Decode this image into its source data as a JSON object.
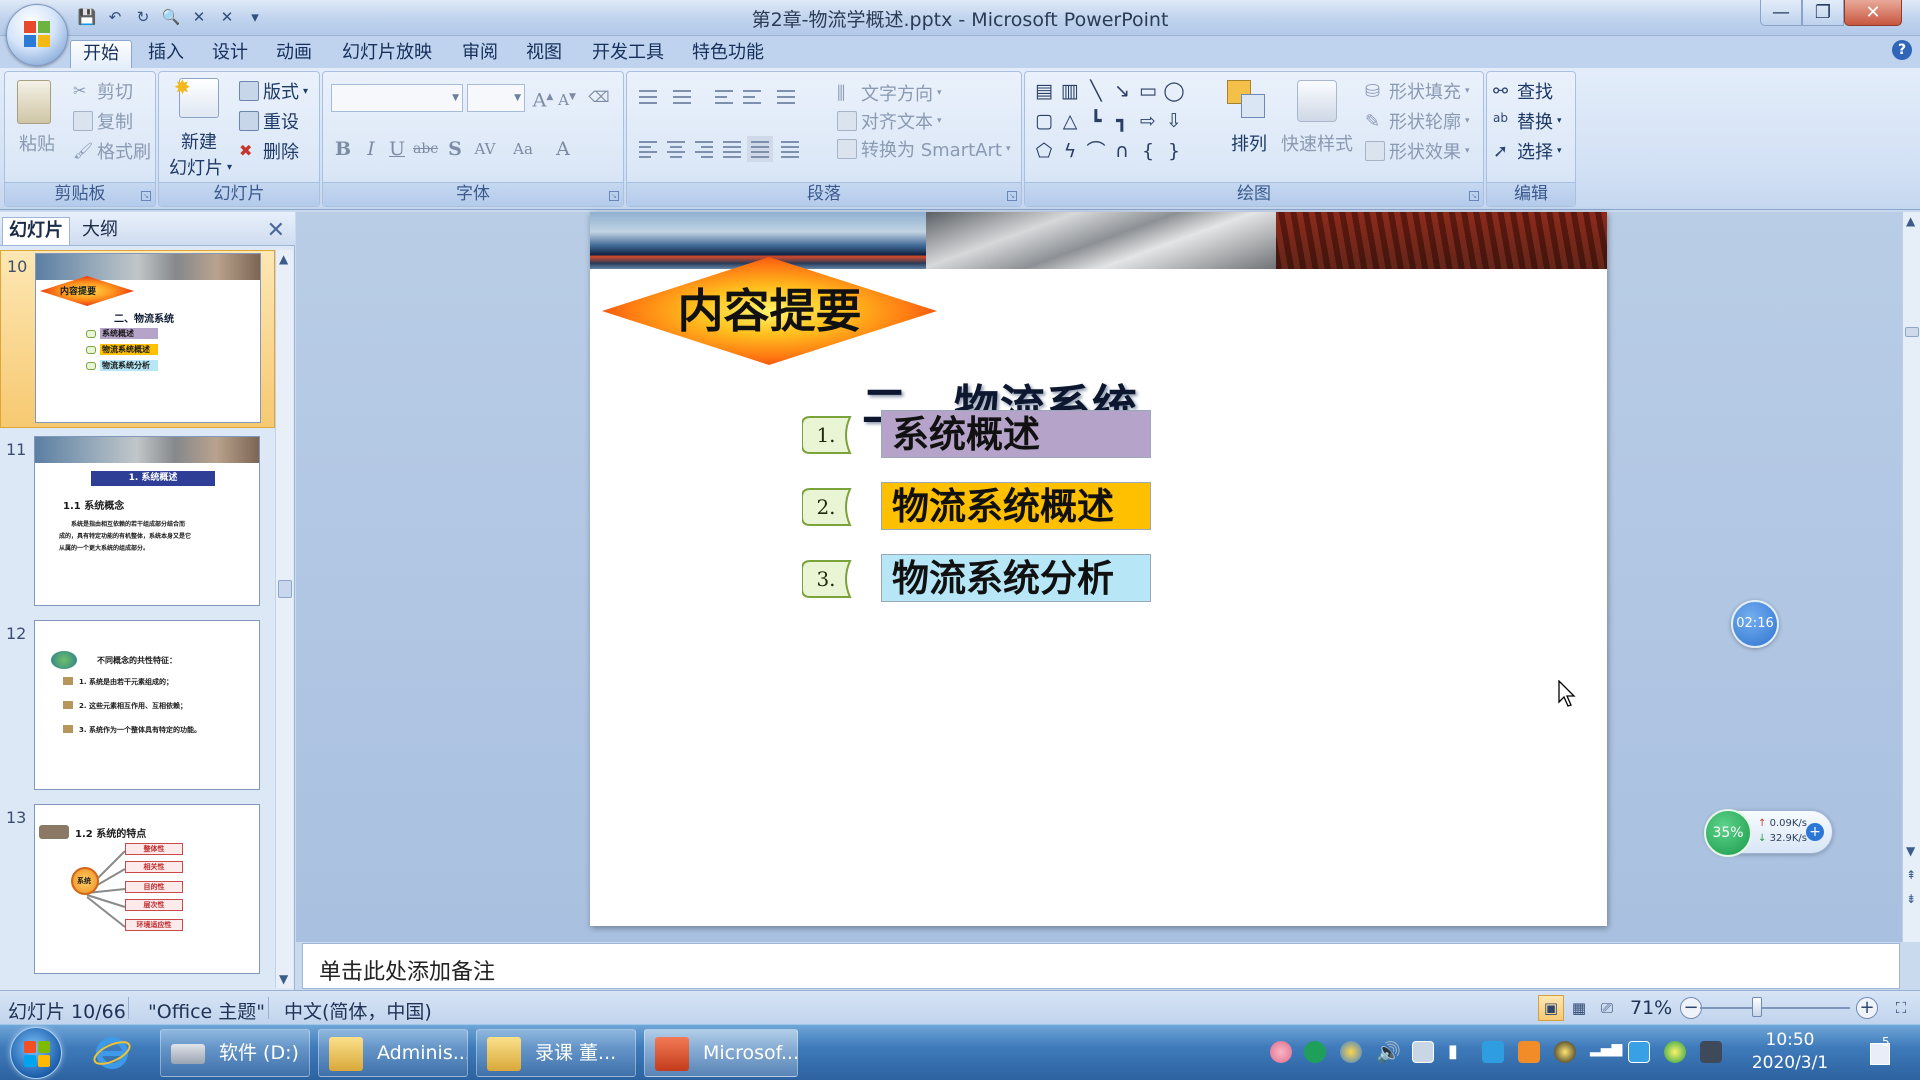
{
  "window": {
    "title": "第2章-物流学概述.pptx - Microsoft PowerPoint",
    "controls": {
      "minimize": "—",
      "maximize": "❐",
      "close": "✕"
    }
  },
  "ribbon_tabs": [
    "开始",
    "插入",
    "设计",
    "动画",
    "幻灯片放映",
    "审阅",
    "视图",
    "开发工具",
    "特色功能"
  ],
  "ribbon": {
    "clipboard": {
      "label": "剪贴板",
      "paste": "粘贴",
      "cut": "剪切",
      "copy": "复制",
      "format_painter": "格式刷"
    },
    "slides": {
      "label": "幻灯片",
      "new_slide": "新建",
      "new_slide_2": "幻灯片",
      "layout": "版式",
      "reset": "重设",
      "delete": "删除"
    },
    "font": {
      "label": "字体",
      "font_name": "",
      "font_size": ""
    },
    "paragraph": {
      "label": "段落",
      "text_direction": "文字方向",
      "align_text": "对齐文本",
      "convert_smartart": "转换为 SmartArt"
    },
    "drawing": {
      "label": "绘图",
      "arrange": "排列",
      "quick_styles": "快速样式",
      "shape_fill": "形状填充",
      "shape_outline": "形状轮廓",
      "shape_effects": "形状效果"
    },
    "editing": {
      "label": "编辑",
      "find": "查找",
      "replace": "替换",
      "select": "选择"
    }
  },
  "left_pane": {
    "tabs": [
      "幻灯片",
      "大纲"
    ],
    "thumbnails": [
      {
        "number": "10",
        "title": "内容提要",
        "heading": "二、物流系统",
        "items": [
          "系统概述",
          "物流系统概述",
          "物流系统分析"
        ]
      },
      {
        "number": "11",
        "title": "1. 系统概述",
        "subtitle": "1.1 系统概念",
        "lines": [
          "系统是指由相互依赖的若干组成部分结合而",
          "成的，具有特定功能的有机整体，系统本身又是它",
          "从属的一个更大系统的组成部分。"
        ]
      },
      {
        "number": "12",
        "title": "不同概念的共性特征：",
        "lines": [
          "1. 系统是由若干元素组成的；",
          "2. 这些元素相互作用、互相依赖；",
          "3. 系统作为一个整体具有特定的功能。"
        ]
      },
      {
        "number": "13",
        "title": "1.2 系统的特点",
        "center": "系统",
        "items": [
          "整体性",
          "相关性",
          "目的性",
          "层次性",
          "环境适应性"
        ]
      }
    ]
  },
  "slide": {
    "badge": "内容提要",
    "heading": "二、物流系统",
    "items": [
      {
        "num": "1.",
        "text": "系统概述",
        "color": "#b5a3c9"
      },
      {
        "num": "2.",
        "text": "物流系统概述",
        "color": "#ffc000"
      },
      {
        "num": "3.",
        "text": "物流系统分析",
        "color": "#b7e6f6"
      }
    ]
  },
  "overlays": {
    "timer": "02:16",
    "cpu_percent": "35%",
    "upload": "0.09K/s",
    "download": "32.9K/s"
  },
  "notes_placeholder": "单击此处添加备注",
  "status": {
    "slide_info": "幻灯片 10/66",
    "theme": "\"Office 主题\"",
    "language": "中文(简体，中国)",
    "zoom": "71%"
  },
  "taskbar": {
    "buttons": [
      "软件 (D:)",
      "Adminis...",
      "录课 董...",
      "Microsof..."
    ],
    "time": "10:50",
    "date": "2020/3/1",
    "notif_count": "5"
  }
}
